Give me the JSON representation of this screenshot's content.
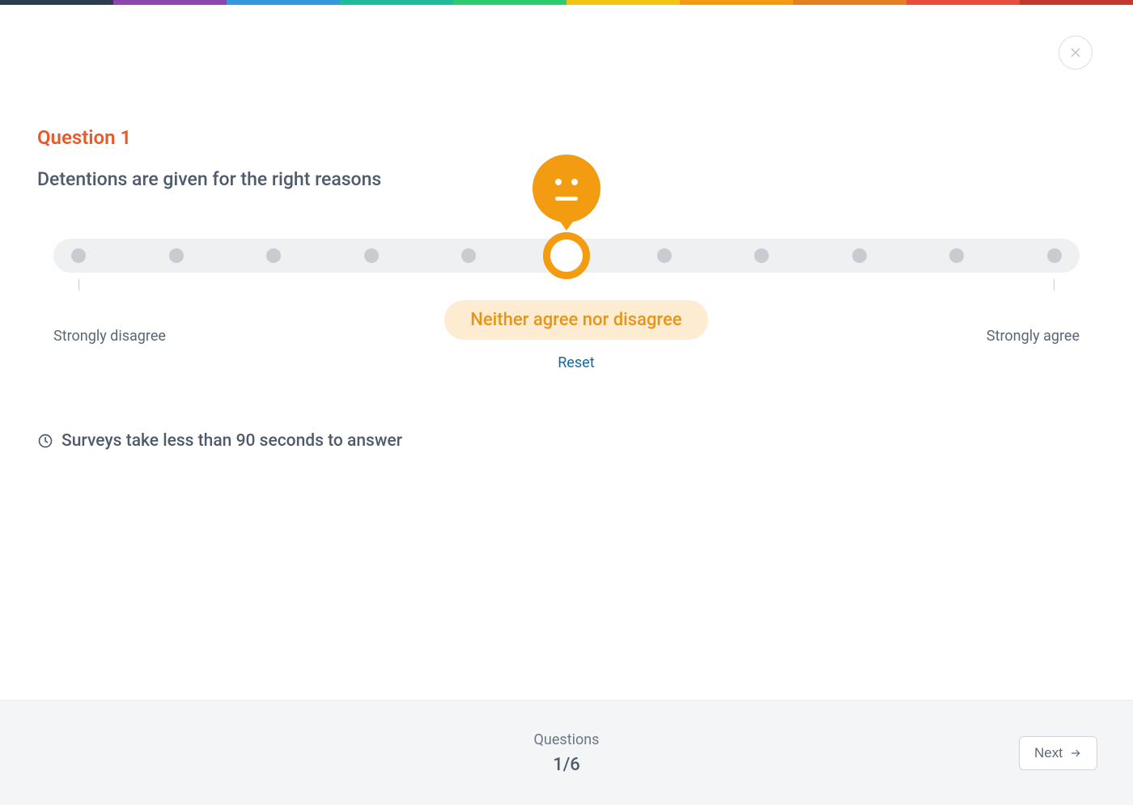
{
  "topbar_colors": [
    "#2b3d4f",
    "#8e44ad",
    "#3498db",
    "#1abc9c",
    "#2ecc71",
    "#f1c40f",
    "#f39c12",
    "#e67e22",
    "#e74c3c",
    "#c0392b"
  ],
  "question": {
    "number_label": "Question 1",
    "text": "Detentions are given for the right reasons"
  },
  "slider": {
    "left_label": "Strongly disagree",
    "right_label": "Strongly agree",
    "selected_label": "Neither agree nor disagree",
    "reset_label": "Reset",
    "accent_color": "#f39c12",
    "pill_bg": "#fdecd2",
    "steps": 11,
    "selected_index": 5
  },
  "hint_text": "Surveys take less than 90 seconds to answer",
  "footer": {
    "label": "Questions",
    "current": "1",
    "total": "6",
    "separator": "/",
    "next_label": "Next"
  }
}
